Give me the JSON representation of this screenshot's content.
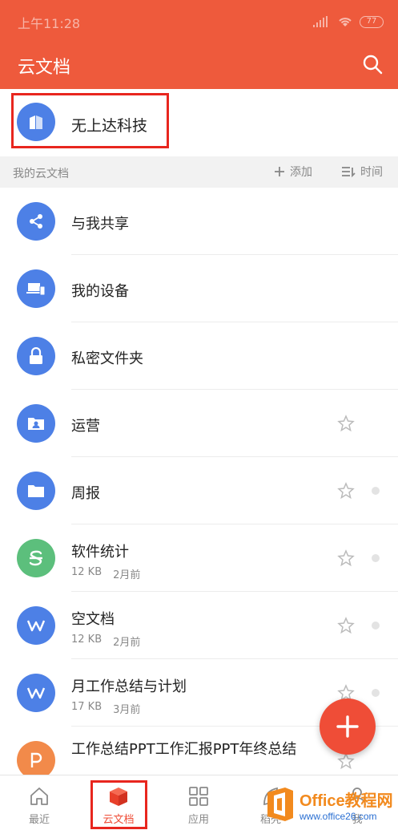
{
  "status_bar": {
    "time": "上午11:28",
    "battery": "77"
  },
  "header": {
    "title": "云文档"
  },
  "team": {
    "name": "无上达科技"
  },
  "section": {
    "title": "我的云文档",
    "add_label": "添加",
    "sort_label": "时间"
  },
  "rows": [
    {
      "title": "与我共享",
      "icon": "share-icon",
      "color": "#4d80e6"
    },
    {
      "title": "我的设备",
      "icon": "devices-icon",
      "color": "#4d80e6"
    },
    {
      "title": "私密文件夹",
      "icon": "lock-icon",
      "color": "#4d80e6"
    },
    {
      "title": "运营",
      "icon": "team-folder-icon",
      "color": "#4d80e6"
    },
    {
      "title": "周报",
      "icon": "folder-icon",
      "color": "#4d80e6"
    },
    {
      "title": "软件统计",
      "size": "12 KB",
      "time": "2月前",
      "icon": "spreadsheet-icon",
      "color": "#5cbf7c"
    },
    {
      "title": "空文档",
      "size": "12 KB",
      "time": "2月前",
      "icon": "word-doc-icon",
      "color": "#4d80e6"
    },
    {
      "title": "月工作总结与计划",
      "size": "17 KB",
      "time": "3月前",
      "icon": "word-doc-icon",
      "color": "#4d80e6"
    },
    {
      "title": "工作总结PPT工作汇报PPT年终总结",
      "icon": "presentation-icon",
      "color": "#f28a4a"
    }
  ],
  "tabs": [
    {
      "label": "最近",
      "icon": "home-icon"
    },
    {
      "label": "云文档",
      "icon": "cube-icon",
      "active": true
    },
    {
      "label": "应用",
      "icon": "apps-grid-icon"
    },
    {
      "label": "稻壳",
      "icon": "docer-icon"
    },
    {
      "label": "我",
      "icon": "profile-icon"
    }
  ],
  "watermark": {
    "main": "Office教程网",
    "sub": "www.office26.com"
  },
  "colors": {
    "brand": "#ee5a3c",
    "accent": "#ef4d37",
    "folder": "#4d80e6",
    "sheet": "#5cbf7c",
    "ppt": "#f28a4a",
    "highlight": "#e8261e"
  }
}
